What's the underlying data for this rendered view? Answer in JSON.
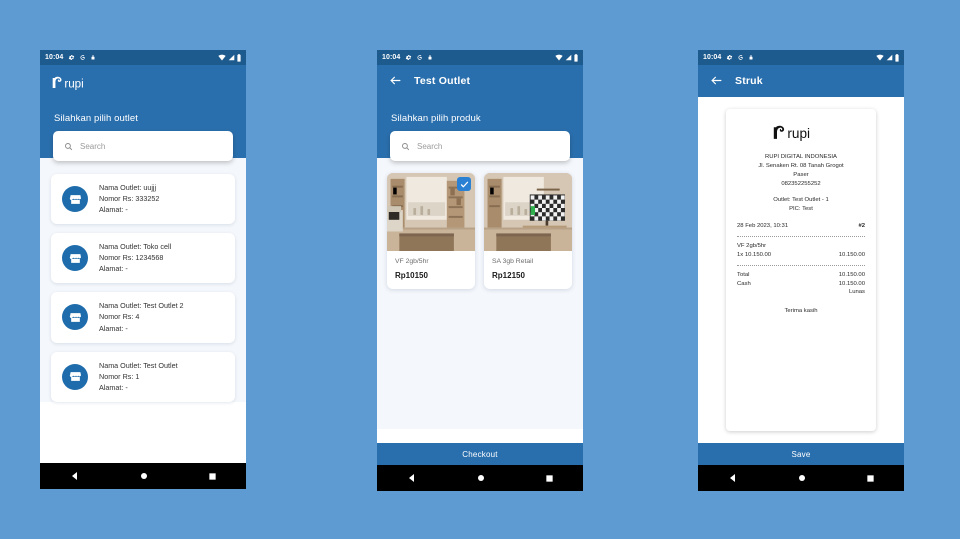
{
  "page": {
    "background_color": "#5e9bd3"
  },
  "statusbar": {
    "time": "10:04",
    "left_icons": [
      "gear-icon",
      "google-g-icon",
      "lock-icon"
    ],
    "right_icons": [
      "wifi-icon",
      "signal-icon",
      "battery-icon"
    ]
  },
  "brand": {
    "name": "rupi",
    "accent_color": "#2a6fad"
  },
  "phone1": {
    "logo_text": "rupi",
    "hero": "Silahkan pilih outlet",
    "search_placeholder": "Search",
    "outlets": [
      {
        "name": "Nama Outlet: uujjj",
        "number": "Nomor Rs: 333252",
        "address": "Alamat: -"
      },
      {
        "name": "Nama Outlet: Toko cell",
        "number": "Nomor Rs: 1234568",
        "address": "Alamat: -"
      },
      {
        "name": "Nama Outlet: Test Outlet 2",
        "number": "Nomor Rs: 4",
        "address": "Alamat: -"
      },
      {
        "name": "Nama Outlet: Test Outlet",
        "number": "Nomor Rs: 1",
        "address": "Alamat: -"
      }
    ]
  },
  "phone2": {
    "title": "Test Outlet",
    "hero": "Silahkan pilih produk",
    "search_placeholder": "Search",
    "products": [
      {
        "name": "VF 2gb/5hr",
        "price": "Rp10150",
        "selected": true
      },
      {
        "name": "SA 3gb Retail",
        "price": "Rp12150",
        "selected": false
      }
    ],
    "checkout_label": "Checkout"
  },
  "phone3": {
    "title": "Struk",
    "save_label": "Save",
    "receipt": {
      "logo_text": "rupi",
      "company": "RUPI DIGITAL INDONESIA",
      "address_line1": "Jl. Senaken Rt. 08 Tanah Grogot",
      "address_line2": "Paser",
      "phone": "082352255252",
      "outlet": "Outlet: Test Outlet - 1",
      "pic": "PIC: Test",
      "datetime": "28 Feb 2023, 10:31",
      "ref": "#2",
      "item_name": "VF 2gb/5hr",
      "item_qty_price": "1x 10.150.00",
      "item_total": "10.150.00",
      "total_label": "Total",
      "total_value": "10.150.00",
      "cash_label": "Cash",
      "cash_value": "10.150.00",
      "status": "Lunas",
      "thanks": "Terima kasih"
    }
  },
  "navbar": {
    "back": "back-triangle-icon",
    "home": "home-circle-icon",
    "recents": "recents-square-icon"
  }
}
